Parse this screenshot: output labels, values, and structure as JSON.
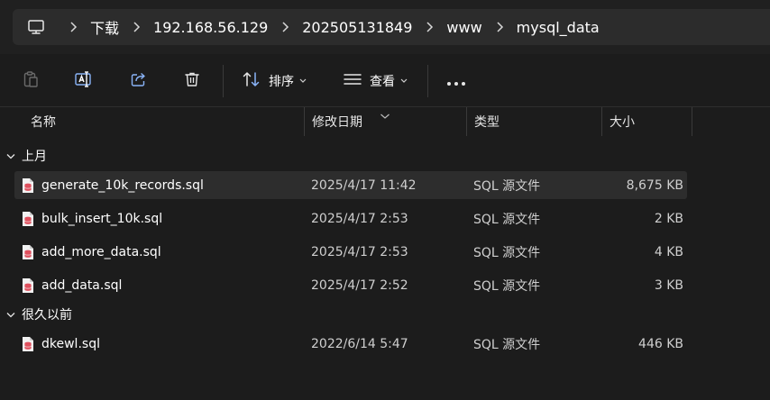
{
  "breadcrumb": [
    "下载",
    "192.168.56.129",
    "202505131849",
    "www",
    "mysql_data"
  ],
  "toolbar": {
    "sort_label": "排序",
    "view_label": "查看"
  },
  "columns": {
    "name": "名称",
    "date": "修改日期",
    "type": "类型",
    "size": "大小"
  },
  "groups": [
    {
      "label": "上月",
      "files": [
        {
          "name": "generate_10k_records.sql",
          "date": "2025/4/17 11:42",
          "type": "SQL 源文件",
          "size": "8,675 KB",
          "selected": true
        },
        {
          "name": "bulk_insert_10k.sql",
          "date": "2025/4/17 2:53",
          "type": "SQL 源文件",
          "size": "2 KB"
        },
        {
          "name": "add_more_data.sql",
          "date": "2025/4/17 2:53",
          "type": "SQL 源文件",
          "size": "4 KB"
        },
        {
          "name": "add_data.sql",
          "date": "2025/4/17 2:52",
          "type": "SQL 源文件",
          "size": "3 KB"
        }
      ]
    },
    {
      "label": "很久以前",
      "files": [
        {
          "name": "dkewl.sql",
          "date": "2022/6/14 5:47",
          "type": "SQL 源文件",
          "size": "446 KB"
        }
      ]
    }
  ],
  "colors": {
    "window_bg": "#1c1c1c",
    "addressbar_bg": "#2c2c2c",
    "selected_row_bg": "#2d2d2d",
    "sql_icon_red": "#e0505e",
    "sql_icon_paper": "#f2f2f2"
  },
  "icons": {
    "pc": "monitor-icon",
    "separator": "chevron-right-icon",
    "paste": "clipboard-icon",
    "rename": "rename-icon",
    "share": "share-icon",
    "delete": "trash-icon",
    "sort": "sort-arrows-icon",
    "view": "view-lines-icon",
    "more": "more-dots-icon",
    "file": "sql-file-icon"
  }
}
